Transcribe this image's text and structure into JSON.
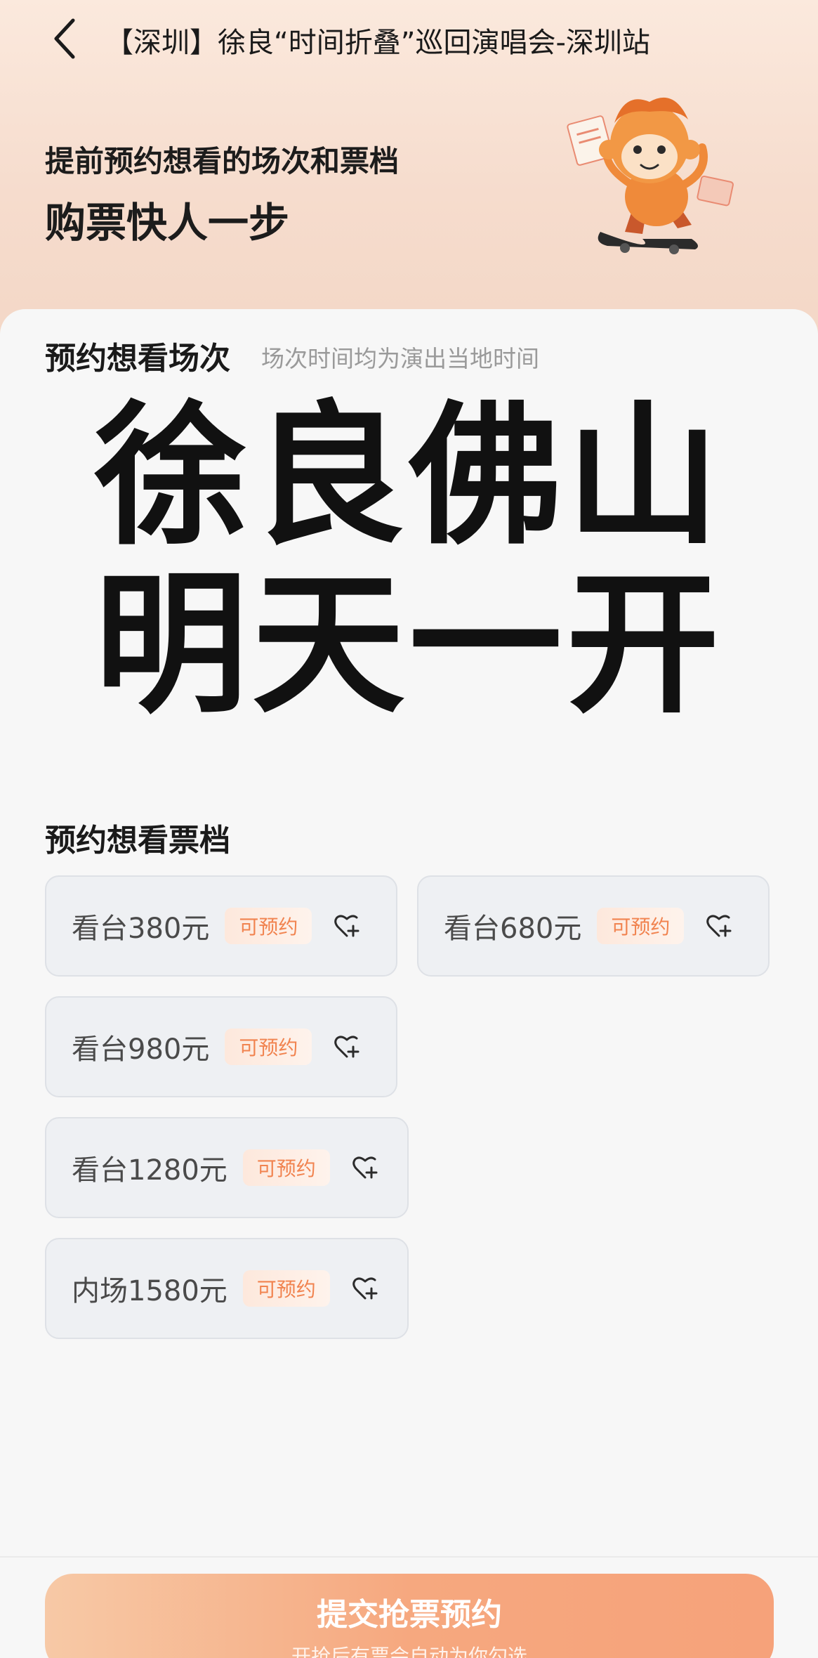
{
  "header": {
    "title": "【深圳】徐良“时间折叠”巡回演唱会-深圳站"
  },
  "promo": {
    "line1": "提前预约想看的场次和票档",
    "line2": "购票快人一步"
  },
  "session_section": {
    "title": "预约想看场次",
    "note": "场次时间均为演出当地时间"
  },
  "overlay": {
    "line1": "徐良佛山",
    "line2": "明天一开"
  },
  "tier_section": {
    "title": "预约想看票档"
  },
  "tickets": [
    {
      "label": "看台380元",
      "badge": "可预约",
      "icon": "heart-plus-icon"
    },
    {
      "label": "看台680元",
      "badge": "可预约",
      "icon": "heart-plus-icon"
    },
    {
      "label": "看台980元",
      "badge": "可预约",
      "icon": "heart-plus-icon"
    },
    {
      "label": "看台1280元",
      "badge": "可预约",
      "icon": "heart-plus-icon"
    },
    {
      "label": "内场1580元",
      "badge": "可预约",
      "icon": "heart-plus-icon"
    }
  ],
  "submit": {
    "label": "提交抢票预约",
    "sublabel": "开抢后有票会自动为你勾选"
  },
  "colors": {
    "accent": "#f1834f",
    "hero_bg": "#f6dccd",
    "button": "#f6a87f"
  }
}
